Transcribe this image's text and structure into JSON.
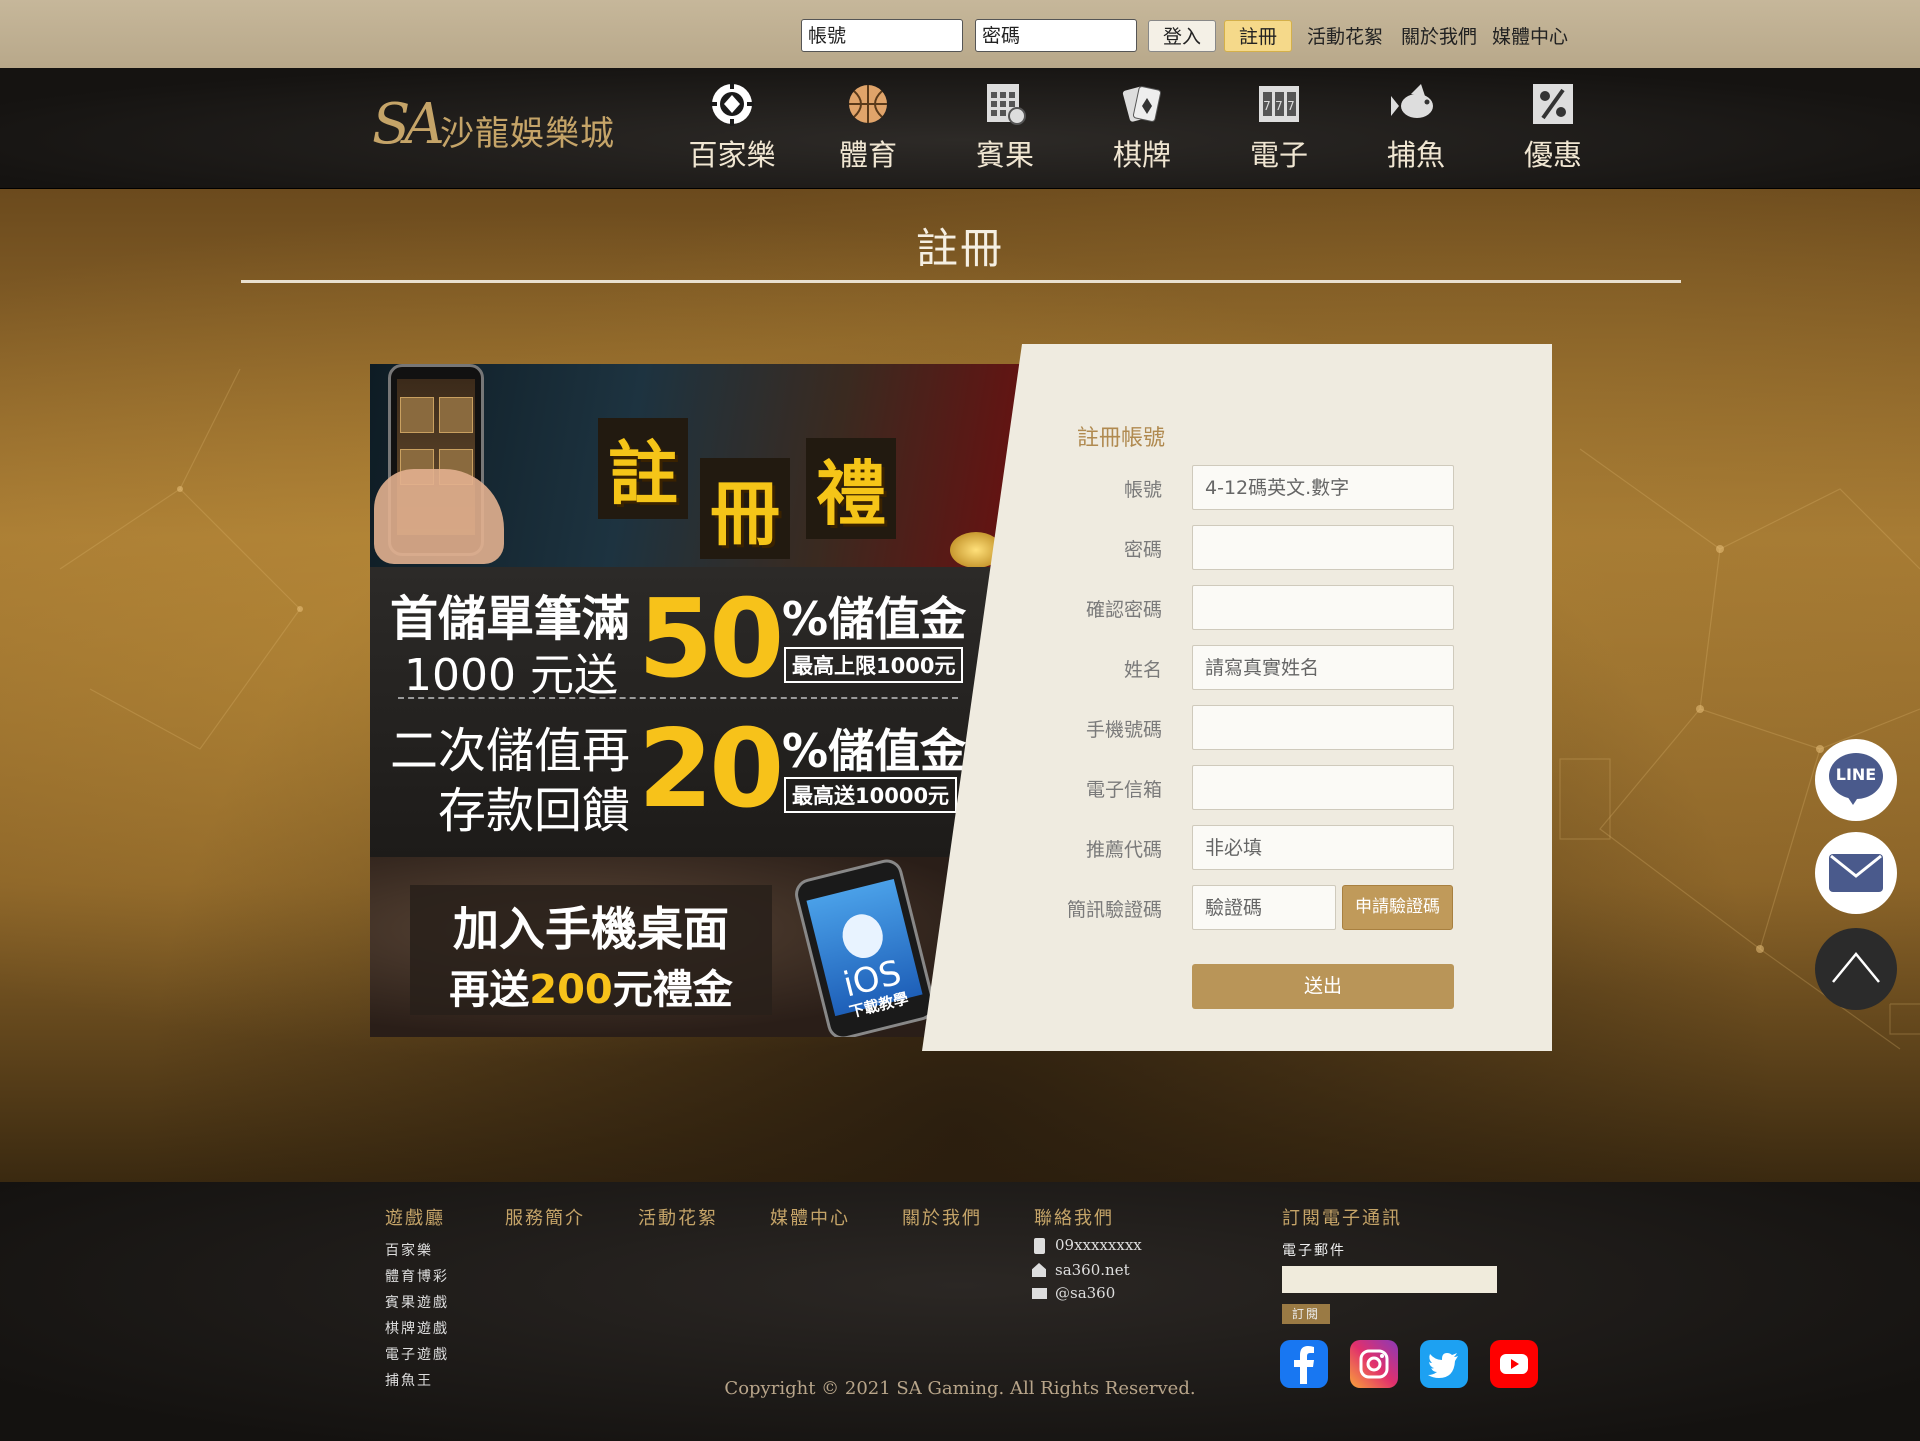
{
  "topbar": {
    "account_placeholder": "帳號",
    "password_placeholder": "密碼",
    "login_label": "登入",
    "register_label": "註冊",
    "links": [
      "活動花絮",
      "關於我們",
      "媒體中心"
    ]
  },
  "nav": {
    "logo_mark": "SA",
    "logo_name": "沙龍娛樂城",
    "items": [
      {
        "label": "百家樂",
        "icon": "baccarat-chip-icon"
      },
      {
        "label": "體育",
        "icon": "basketball-icon"
      },
      {
        "label": "賓果",
        "icon": "bingo-card-icon"
      },
      {
        "label": "棋牌",
        "icon": "playing-cards-icon"
      },
      {
        "label": "電子",
        "icon": "slot-machine-icon"
      },
      {
        "label": "捕魚",
        "icon": "fish-icon"
      },
      {
        "label": "優惠",
        "icon": "discount-icon"
      }
    ]
  },
  "page": {
    "title": "註冊"
  },
  "promo": {
    "reg_chars": [
      "註",
      "冊",
      "禮"
    ],
    "line1_a": "首儲單筆滿",
    "line1_b": "1000 元送",
    "num1": "50",
    "pct1": "%儲值金",
    "cap1": "最高上限1000元",
    "line2_a": "二次儲值再",
    "line2_b": "存款回饋",
    "num2": "20",
    "pct2": "%儲值金",
    "cap2": "最高送10000元",
    "join_1": "加入手機桌面",
    "join_2_pre": "再送",
    "join_2_amount": "200",
    "join_2_post": "元禮金",
    "ios_title": "iOS",
    "ios_sub": "下載教學"
  },
  "form": {
    "heading": "註冊帳號",
    "fields": [
      {
        "label": "帳號",
        "placeholder": "4-12碼英文.數字"
      },
      {
        "label": "密碼",
        "placeholder": ""
      },
      {
        "label": "確認密碼",
        "placeholder": ""
      },
      {
        "label": "姓名",
        "placeholder": "請寫真實姓名"
      },
      {
        "label": "手機號碼",
        "placeholder": ""
      },
      {
        "label": "電子信箱",
        "placeholder": ""
      },
      {
        "label": "推薦代碼",
        "placeholder": "非必填"
      }
    ],
    "sms_label": "簡訊驗證碼",
    "sms_placeholder": "驗證碼",
    "sms_button": "申請驗證碼",
    "submit": "送出"
  },
  "floaters": {
    "line_label": "LINE"
  },
  "footer": {
    "headings": [
      "遊戲廳",
      "服務簡介",
      "活動花絮",
      "媒體中心",
      "關於我們",
      "聯絡我們",
      "訂閱電子通訊"
    ],
    "games": [
      "百家樂",
      "體育博彩",
      "賓果遊戲",
      "棋牌遊戲",
      "電子遊戲",
      "捕魚王"
    ],
    "contact": [
      "09xxxxxxxx",
      "sa360.net",
      "@sa360"
    ],
    "subscribe_label": "電子郵件",
    "subscribe_button": "訂閱",
    "copyright": "Copyright © 2021 SA Gaming. All Rights Reserved."
  },
  "colors": {
    "gold": "#c5a468",
    "accent_yellow": "#f7c21a",
    "form_bg": "#efebe0",
    "button_gold": "#b99558"
  }
}
